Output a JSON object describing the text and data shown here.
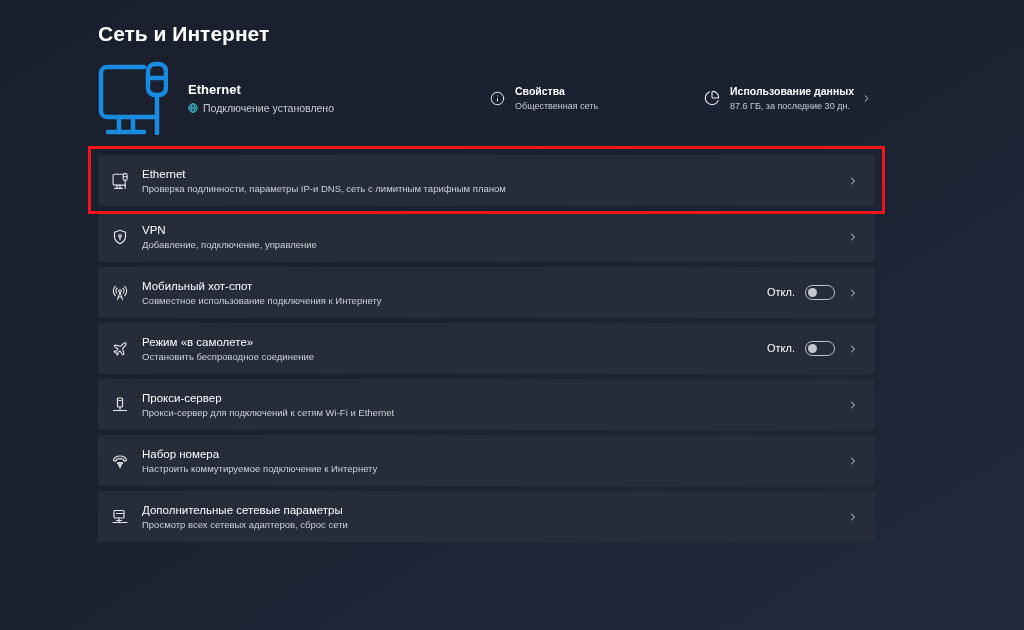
{
  "page": {
    "title": "Сеть и Интернет"
  },
  "connection": {
    "name": "Ethernet",
    "status": "Подключение установлено"
  },
  "properties": {
    "title": "Свойства",
    "subtitle": "Общественная сеть"
  },
  "data_usage": {
    "title": "Использование данных",
    "subtitle": "87.6 ГБ, за последние 30 дн."
  },
  "items": [
    {
      "kind": "link",
      "title": "Ethernet",
      "subtitle": "Проверка подлинности, параметры IP-и DNS, сеть с лимитным тарифным планом",
      "highlighted": true
    },
    {
      "kind": "link",
      "title": "VPN",
      "subtitle": "Добавление, подключение, управление",
      "highlighted": false
    },
    {
      "kind": "toggle",
      "title": "Мобильный хот-спот",
      "subtitle": "Совместное использование подключения к Интернету",
      "state_label": "Откл.",
      "on": false,
      "highlighted": false
    },
    {
      "kind": "toggle",
      "title": "Режим «в самолете»",
      "subtitle": "Остановить беспроводное соединение",
      "state_label": "Откл.",
      "on": false,
      "highlighted": false
    },
    {
      "kind": "link",
      "title": "Прокси-сервер",
      "subtitle": "Прокси-сервер для подключений к сетям Wi-Fi и Ethernet",
      "highlighted": false
    },
    {
      "kind": "link",
      "title": "Набор номера",
      "subtitle": "Настроить коммутируемое подключение к Интернету",
      "highlighted": false
    },
    {
      "kind": "link",
      "title": "Дополнительные сетевые параметры",
      "subtitle": "Просмотр всех сетевых адаптеров, сброс сети",
      "highlighted": false
    }
  ]
}
